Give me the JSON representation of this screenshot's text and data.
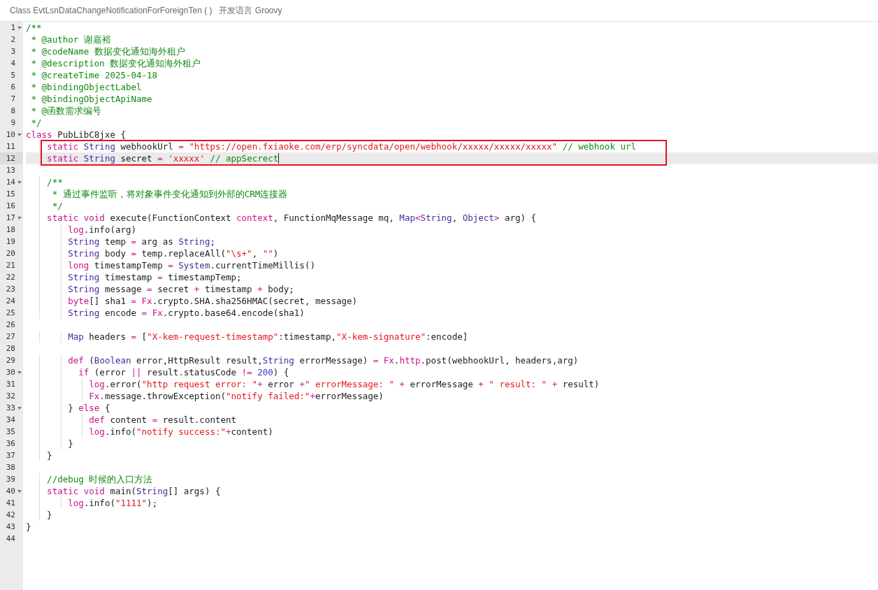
{
  "header": {
    "title": "Class EvtLsnDataChangeNotificationForForeignTen ( )",
    "language": "开发语言 Groovy"
  },
  "editor": {
    "lines": [
      {
        "number": "1",
        "foldable": true,
        "tokens": [
          {
            "kind": "comment",
            "text": "/**"
          }
        ]
      },
      {
        "number": "2",
        "tokens": [
          {
            "kind": "comment",
            "text": " * @author 谢嘉裕"
          }
        ]
      },
      {
        "number": "3",
        "tokens": [
          {
            "kind": "comment",
            "text": " * @codeName 数据变化通知海外租户"
          }
        ]
      },
      {
        "number": "4",
        "tokens": [
          {
            "kind": "comment",
            "text": " * @description 数据变化通知海外租户"
          }
        ]
      },
      {
        "number": "5",
        "tokens": [
          {
            "kind": "comment",
            "text": " * @createTime 2025-04-18"
          }
        ]
      },
      {
        "number": "6",
        "tokens": [
          {
            "kind": "comment",
            "text": " * @bindingObjectLabel"
          }
        ]
      },
      {
        "number": "7",
        "tokens": [
          {
            "kind": "comment",
            "text": " * @bindingObjectApiName"
          }
        ]
      },
      {
        "number": "8",
        "tokens": [
          {
            "kind": "comment",
            "text": " * @函数需求编号"
          }
        ]
      },
      {
        "number": "9",
        "tokens": [
          {
            "kind": "comment",
            "text": " */"
          }
        ]
      },
      {
        "number": "10",
        "foldable": true,
        "tokens": [
          {
            "kind": "keyword",
            "text": "class"
          },
          {
            "kind": "plain",
            "text": " PubLibC8jxe {"
          }
        ]
      },
      {
        "number": "11",
        "boxed": true,
        "tokens": [
          {
            "kind": "keyword",
            "text": "    static "
          },
          {
            "kind": "type",
            "text": "String"
          },
          {
            "kind": "plain",
            "text": " webhookUrl "
          },
          {
            "kind": "keyword",
            "text": "= "
          },
          {
            "kind": "string",
            "text": "\"https://open.fxiaoke.com/erp/syncdata/open/webhook/xxxxx/xxxxx/xxxxx\" "
          },
          {
            "kind": "comment",
            "text": "// webhook url"
          }
        ]
      },
      {
        "number": "12",
        "boxed": true,
        "active": true,
        "tokens": [
          {
            "kind": "keyword",
            "text": "    static "
          },
          {
            "kind": "type",
            "text": "String"
          },
          {
            "kind": "plain",
            "text": " secret "
          },
          {
            "kind": "keyword",
            "text": "= "
          },
          {
            "kind": "string",
            "text": "'xxxxx' "
          },
          {
            "kind": "comment",
            "text": "// appSecrect"
          }
        ]
      },
      {
        "number": "13"
      },
      {
        "number": "14",
        "foldable": true,
        "tokens": [
          {
            "kind": "comment",
            "text": "    /**"
          }
        ]
      },
      {
        "number": "15",
        "tokens": [
          {
            "kind": "comment",
            "text": "     * 通过事件监听，将对象事件变化通知到外部的CRM连接器"
          }
        ]
      },
      {
        "number": "16",
        "tokens": [
          {
            "kind": "comment",
            "text": "     */"
          }
        ]
      },
      {
        "number": "17",
        "foldable": true,
        "tokens": [
          {
            "kind": "keyword",
            "text": "    static void"
          },
          {
            "kind": "plain",
            "text": " execute(FunctionContext "
          },
          {
            "kind": "keyword",
            "text": "context"
          },
          {
            "kind": "plain",
            "text": ", FunctionMqMessage mq, "
          },
          {
            "kind": "type",
            "text": "Map"
          },
          {
            "kind": "keyword",
            "text": "<"
          },
          {
            "kind": "type",
            "text": "String"
          },
          {
            "kind": "plain",
            "text": ", "
          },
          {
            "kind": "type",
            "text": "Object"
          },
          {
            "kind": "keyword",
            "text": ">"
          },
          {
            "kind": "plain",
            "text": " arg) {"
          }
        ]
      },
      {
        "number": "18",
        "tokens": [
          {
            "kind": "keyword",
            "text": "        log"
          },
          {
            "kind": "plain",
            "text": ".info(arg)"
          }
        ]
      },
      {
        "number": "19",
        "tokens": [
          {
            "kind": "type",
            "text": "        String"
          },
          {
            "kind": "plain",
            "text": " temp "
          },
          {
            "kind": "keyword",
            "text": "="
          },
          {
            "kind": "plain",
            "text": " arg as "
          },
          {
            "kind": "type",
            "text": "String"
          },
          {
            "kind": "plain",
            "text": ";"
          }
        ]
      },
      {
        "number": "20",
        "tokens": [
          {
            "kind": "type",
            "text": "        String"
          },
          {
            "kind": "plain",
            "text": " body "
          },
          {
            "kind": "keyword",
            "text": "="
          },
          {
            "kind": "plain",
            "text": " temp.replaceAll("
          },
          {
            "kind": "string",
            "text": "\"\\s+\""
          },
          {
            "kind": "plain",
            "text": ", "
          },
          {
            "kind": "string",
            "text": "\"\""
          },
          {
            "kind": "plain",
            "text": ")"
          }
        ]
      },
      {
        "number": "21",
        "tokens": [
          {
            "kind": "keyword",
            "text": "        long"
          },
          {
            "kind": "plain",
            "text": " timestampTemp "
          },
          {
            "kind": "keyword",
            "text": "= "
          },
          {
            "kind": "type",
            "text": "System"
          },
          {
            "kind": "plain",
            "text": ".currentTimeMillis()"
          }
        ]
      },
      {
        "number": "22",
        "tokens": [
          {
            "kind": "type",
            "text": "        String"
          },
          {
            "kind": "plain",
            "text": " timestamp "
          },
          {
            "kind": "keyword",
            "text": "="
          },
          {
            "kind": "plain",
            "text": " timestampTemp;"
          }
        ]
      },
      {
        "number": "23",
        "tokens": [
          {
            "kind": "type",
            "text": "        String"
          },
          {
            "kind": "plain",
            "text": " message "
          },
          {
            "kind": "keyword",
            "text": "="
          },
          {
            "kind": "plain",
            "text": " secret "
          },
          {
            "kind": "keyword",
            "text": "+"
          },
          {
            "kind": "plain",
            "text": " timestamp "
          },
          {
            "kind": "keyword",
            "text": "+"
          },
          {
            "kind": "plain",
            "text": " body;"
          }
        ]
      },
      {
        "number": "24",
        "tokens": [
          {
            "kind": "keyword",
            "text": "        byte"
          },
          {
            "kind": "plain",
            "text": "[] sha1 "
          },
          {
            "kind": "keyword",
            "text": "= Fx"
          },
          {
            "kind": "plain",
            "text": ".crypto.SHA.sha256HMAC(secret, message)"
          }
        ]
      },
      {
        "number": "25",
        "tokens": [
          {
            "kind": "type",
            "text": "        String"
          },
          {
            "kind": "plain",
            "text": " encode "
          },
          {
            "kind": "keyword",
            "text": "= Fx"
          },
          {
            "kind": "plain",
            "text": ".crypto.base64.encode(sha1)"
          }
        ]
      },
      {
        "number": "26"
      },
      {
        "number": "27",
        "tokens": [
          {
            "kind": "type",
            "text": "        Map"
          },
          {
            "kind": "plain",
            "text": " headers "
          },
          {
            "kind": "keyword",
            "text": "="
          },
          {
            "kind": "plain",
            "text": " ["
          },
          {
            "kind": "string",
            "text": "\"X-kem-request-timestamp\""
          },
          {
            "kind": "plain",
            "text": ":timestamp,"
          },
          {
            "kind": "string",
            "text": "\"X-kem-signature\""
          },
          {
            "kind": "plain",
            "text": ":encode]"
          }
        ]
      },
      {
        "number": "28"
      },
      {
        "number": "29",
        "tokens": [
          {
            "kind": "keyword",
            "text": "        def"
          },
          {
            "kind": "plain",
            "text": " ("
          },
          {
            "kind": "type",
            "text": "Boolean"
          },
          {
            "kind": "plain",
            "text": " error,HttpResult result,"
          },
          {
            "kind": "type",
            "text": "String"
          },
          {
            "kind": "plain",
            "text": " errorMessage) "
          },
          {
            "kind": "keyword",
            "text": "= Fx"
          },
          {
            "kind": "plain",
            "text": "."
          },
          {
            "kind": "keyword",
            "text": "http"
          },
          {
            "kind": "plain",
            "text": ".post(webhookUrl, headers,arg)"
          }
        ]
      },
      {
        "number": "30",
        "foldable": true,
        "tokens": [
          {
            "kind": "keyword",
            "text": "          if"
          },
          {
            "kind": "plain",
            "text": " (error "
          },
          {
            "kind": "keyword",
            "text": "||"
          },
          {
            "kind": "plain",
            "text": " result.statusCode "
          },
          {
            "kind": "keyword",
            "text": "!= "
          },
          {
            "kind": "number",
            "text": "200"
          },
          {
            "kind": "plain",
            "text": ") {"
          }
        ]
      },
      {
        "number": "31",
        "tokens": [
          {
            "kind": "keyword",
            "text": "            log"
          },
          {
            "kind": "plain",
            "text": ".error("
          },
          {
            "kind": "string",
            "text": "\"http request error: \""
          },
          {
            "kind": "keyword",
            "text": "+"
          },
          {
            "kind": "plain",
            "text": " error "
          },
          {
            "kind": "keyword",
            "text": "+"
          },
          {
            "kind": "string",
            "text": "\" errorMessage: \""
          },
          {
            "kind": "keyword",
            "text": " +"
          },
          {
            "kind": "plain",
            "text": " errorMessage "
          },
          {
            "kind": "keyword",
            "text": "+ "
          },
          {
            "kind": "string",
            "text": "\" result: \""
          },
          {
            "kind": "keyword",
            "text": " +"
          },
          {
            "kind": "plain",
            "text": " result)"
          }
        ]
      },
      {
        "number": "32",
        "tokens": [
          {
            "kind": "keyword",
            "text": "            Fx"
          },
          {
            "kind": "plain",
            "text": ".message.throwException("
          },
          {
            "kind": "string",
            "text": "\"notify failed:\""
          },
          {
            "kind": "keyword",
            "text": "+"
          },
          {
            "kind": "plain",
            "text": "errorMessage)"
          }
        ]
      },
      {
        "number": "33",
        "foldable": true,
        "tokens": [
          {
            "kind": "plain",
            "text": "        } "
          },
          {
            "kind": "keyword",
            "text": "else"
          },
          {
            "kind": "plain",
            "text": " {"
          }
        ]
      },
      {
        "number": "34",
        "tokens": [
          {
            "kind": "keyword",
            "text": "            def"
          },
          {
            "kind": "plain",
            "text": " content "
          },
          {
            "kind": "keyword",
            "text": "="
          },
          {
            "kind": "plain",
            "text": " result.content"
          }
        ]
      },
      {
        "number": "35",
        "tokens": [
          {
            "kind": "keyword",
            "text": "            log"
          },
          {
            "kind": "plain",
            "text": ".info("
          },
          {
            "kind": "string",
            "text": "\"notify success:\""
          },
          {
            "kind": "keyword",
            "text": "+"
          },
          {
            "kind": "plain",
            "text": "content)"
          }
        ]
      },
      {
        "number": "36",
        "tokens": [
          {
            "kind": "plain",
            "text": "        }"
          }
        ]
      },
      {
        "number": "37",
        "tokens": [
          {
            "kind": "plain",
            "text": "    }"
          }
        ]
      },
      {
        "number": "38"
      },
      {
        "number": "39",
        "tokens": [
          {
            "kind": "comment",
            "text": "    //debug 时候的入口方法"
          }
        ]
      },
      {
        "number": "40",
        "foldable": true,
        "tokens": [
          {
            "kind": "keyword",
            "text": "    static void"
          },
          {
            "kind": "plain",
            "text": " main("
          },
          {
            "kind": "type",
            "text": "String"
          },
          {
            "kind": "plain",
            "text": "[] args) {"
          }
        ]
      },
      {
        "number": "41",
        "tokens": [
          {
            "kind": "keyword",
            "text": "        log"
          },
          {
            "kind": "plain",
            "text": ".info("
          },
          {
            "kind": "string",
            "text": "\"1111\""
          },
          {
            "kind": "plain",
            "text": ");"
          }
        ]
      },
      {
        "number": "42",
        "tokens": [
          {
            "kind": "plain",
            "text": "    }"
          }
        ]
      },
      {
        "number": "43",
        "tokens": [
          {
            "kind": "plain",
            "text": "}"
          }
        ]
      },
      {
        "number": "44"
      }
    ]
  }
}
